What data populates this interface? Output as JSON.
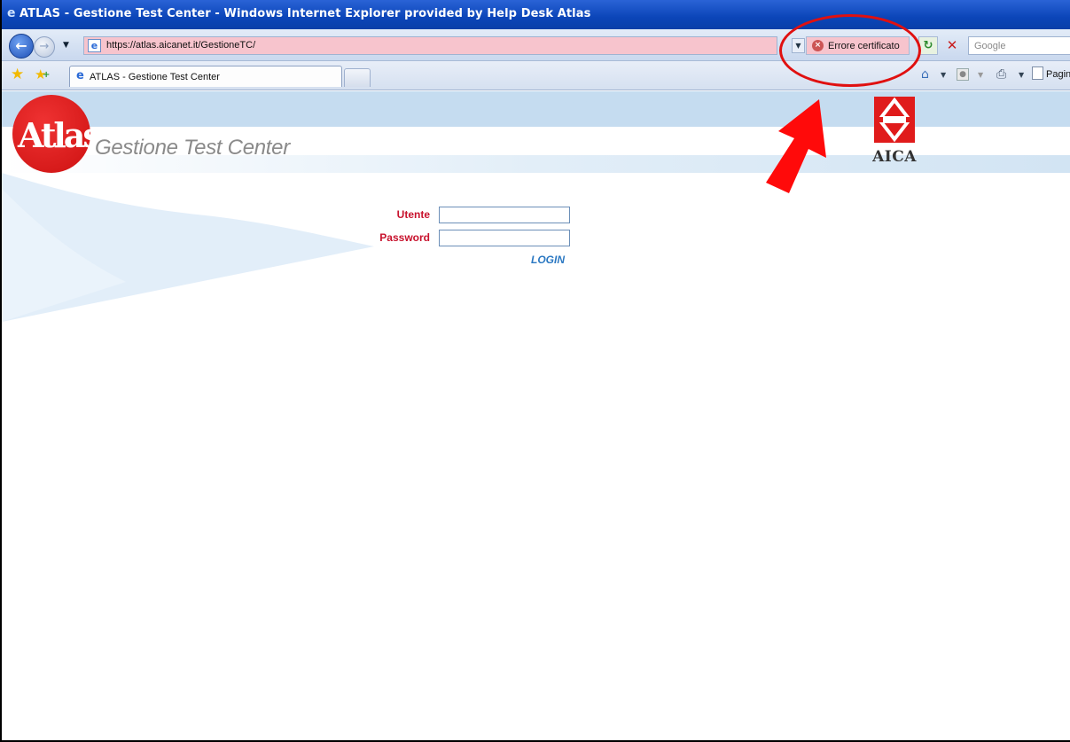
{
  "window": {
    "title": "ATLAS - Gestione Test Center - Windows Internet Explorer provided by Help Desk Atlas"
  },
  "address_bar": {
    "url": "https://atlas.aicanet.it/GestioneTC/",
    "certificate_error": "Errore certificato",
    "search_placeholder": "Google"
  },
  "tabs": [
    {
      "label": "ATLAS - Gestione Test Center"
    }
  ],
  "command_bar": {
    "page_label": "Pagin"
  },
  "page": {
    "logo_text": "Atlas",
    "app_title": "Gestione Test Center",
    "aica_label": "AICA",
    "login": {
      "user_label": "Utente",
      "user_value": "",
      "password_label": "Password",
      "password_value": "",
      "submit_label": "LOGIN"
    }
  },
  "annotation": {
    "color": "#e01010"
  }
}
